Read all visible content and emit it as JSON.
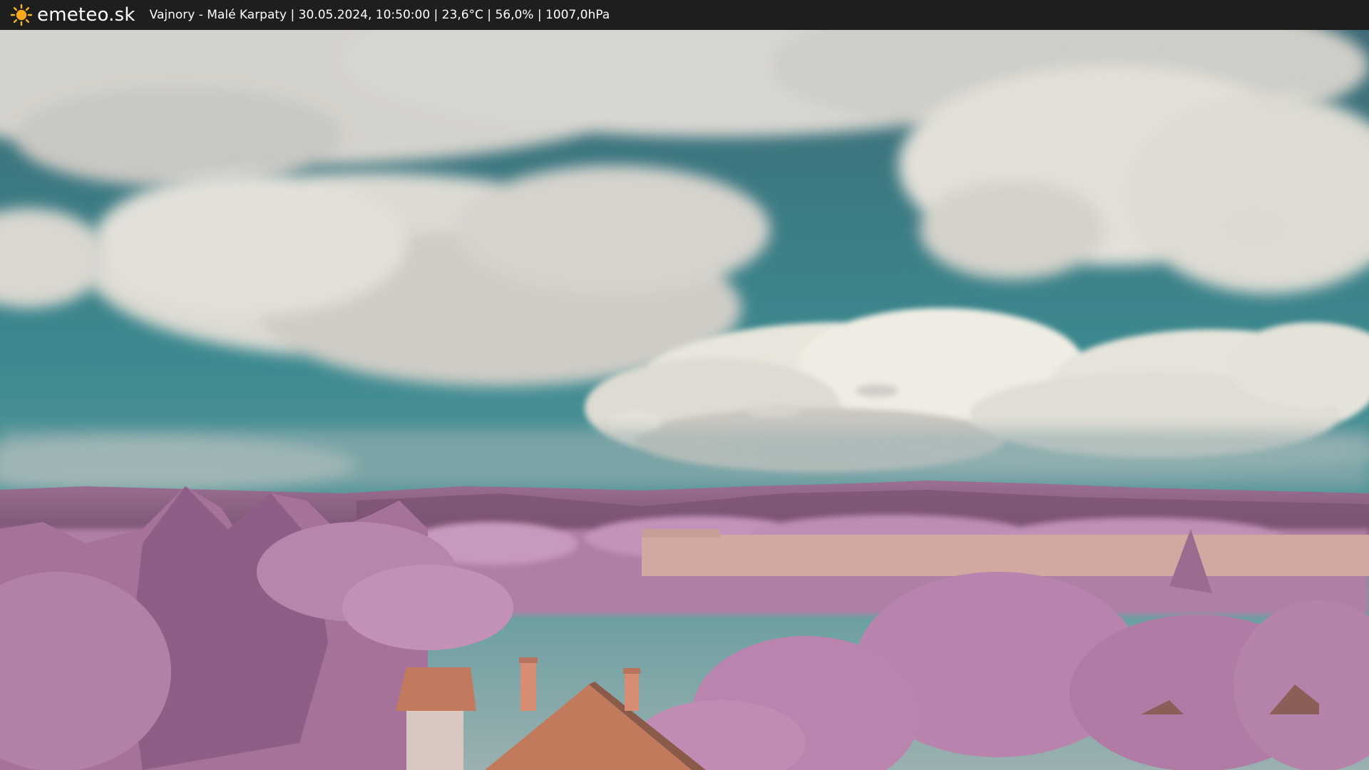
{
  "header": {
    "brand": "emeteo.sk",
    "logo_icon": "sun-icon",
    "caption": "Vajnory - Malé Karpaty | 30.05.2024, 10:50:00 | 23,6°C | 56,0% | 1007,0hPa"
  },
  "scene": {
    "colors": {
      "sky_top": "#3d6a75",
      "sky_mid": "#3c8a90",
      "sky_low": "#6a9ea0",
      "cloud": "#e4e2da",
      "cloud_shadow": "#a8a4a4",
      "hills": "#8a5f80",
      "trees": "#b784ad",
      "roof": "#c07a5e",
      "wall": "#d6b0a4"
    }
  }
}
